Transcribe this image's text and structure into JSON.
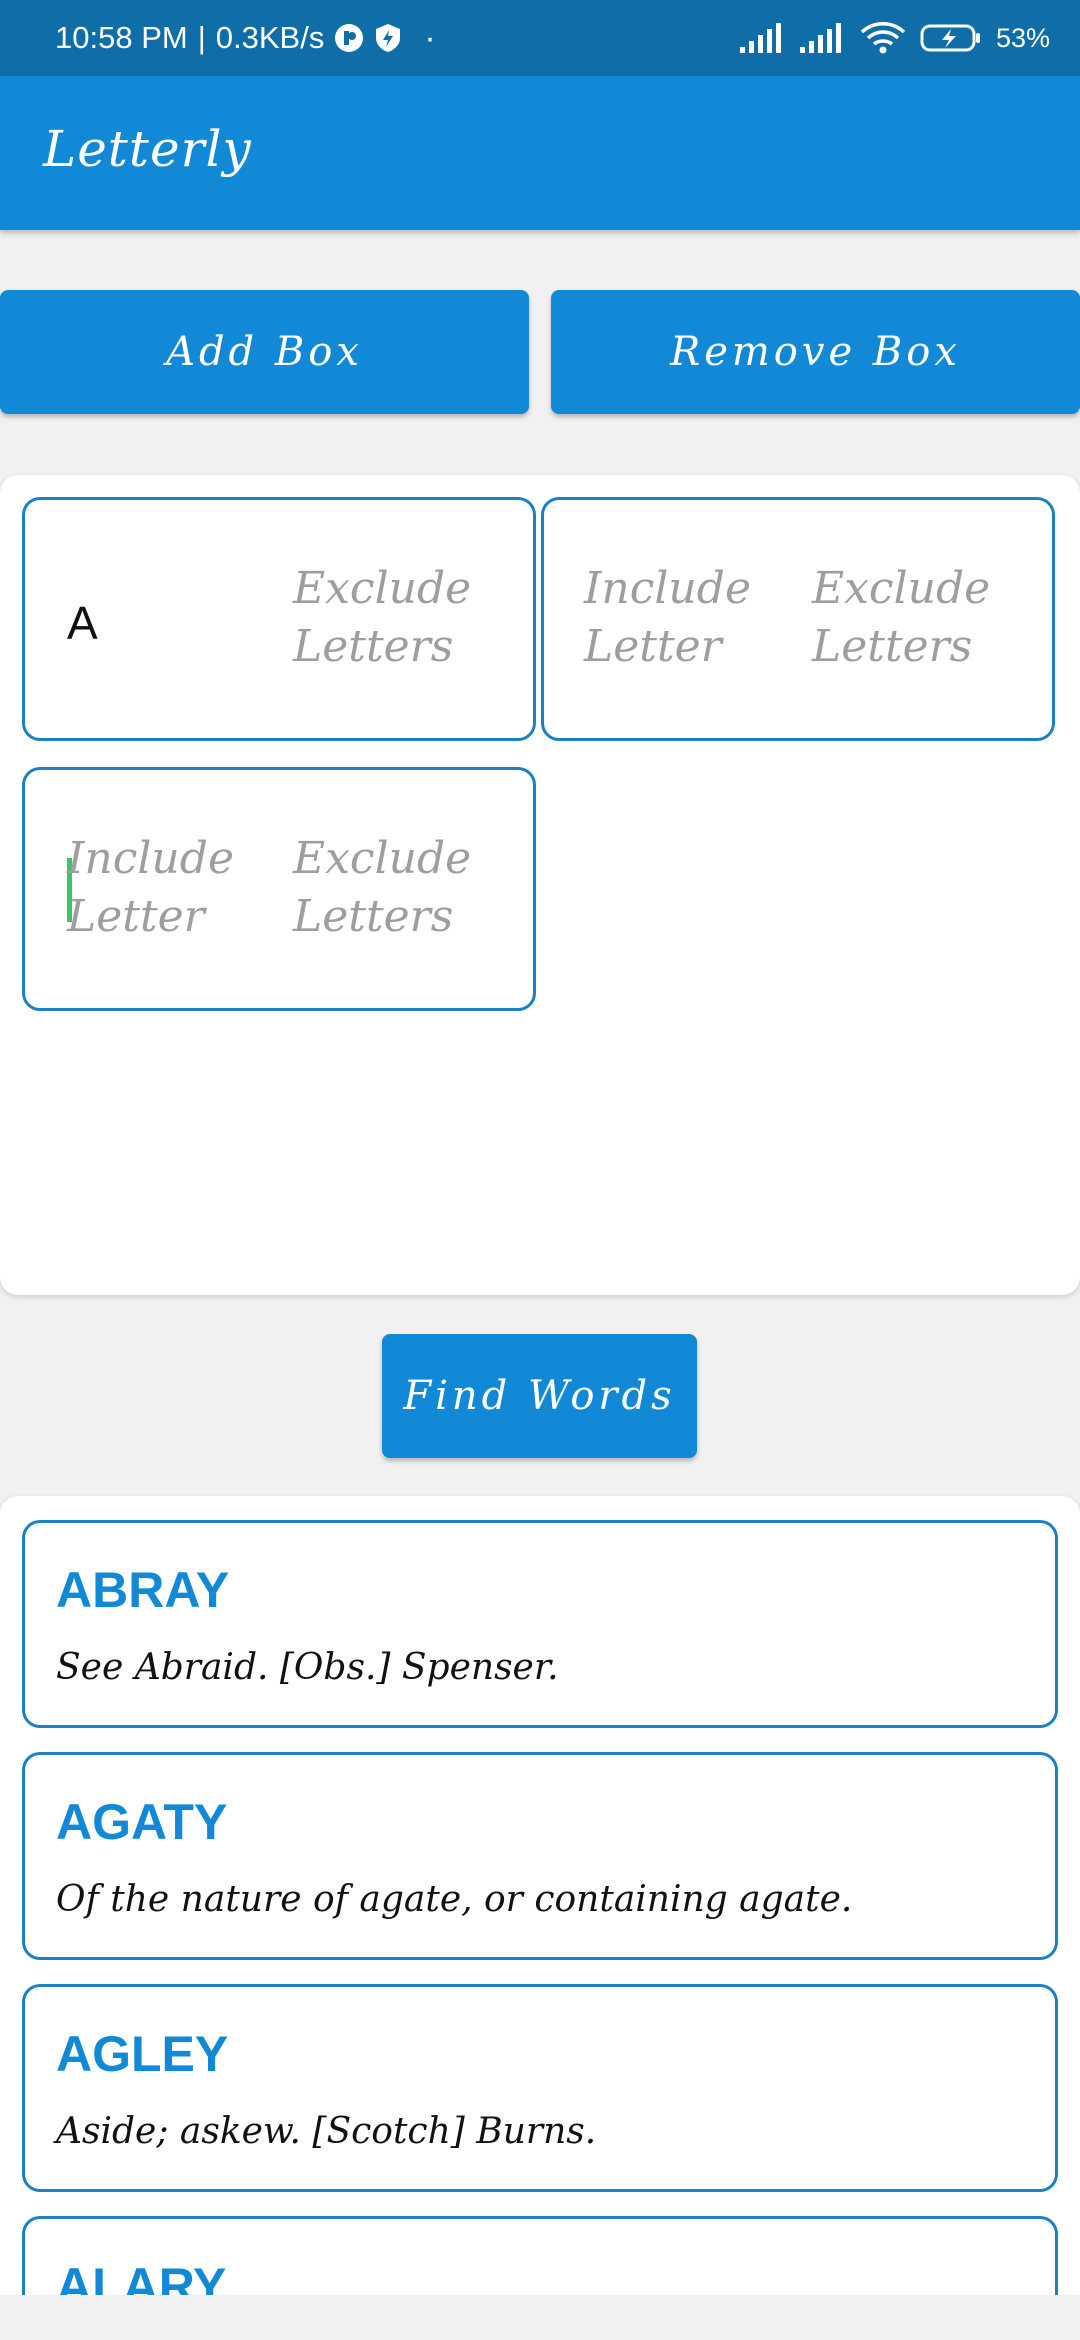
{
  "status_bar": {
    "time": "10:58 PM",
    "separator": "|",
    "speed": "0.3KB/s",
    "dot": "·",
    "battery": "53%",
    "icons": [
      "notification-app-icon",
      "shield-bolt-icon",
      "signal-icon",
      "signal-icon",
      "wifi-icon",
      "battery-charging-icon"
    ]
  },
  "app_bar": {
    "title": "Letterly"
  },
  "controls": {
    "add_box": "Add Box",
    "remove_box": "Remove Box",
    "find_words": "Find Words"
  },
  "boxes": [
    {
      "include_value": "A",
      "include_placeholder": "",
      "exclude_placeholder": "Exclude\nLetters"
    },
    {
      "include_value": "",
      "include_placeholder": "Include\nLetter",
      "exclude_placeholder": "Exclude\nLetters"
    },
    {
      "include_value": "",
      "include_placeholder": "Include\nLetter",
      "exclude_placeholder": "Exclude\nLetters"
    }
  ],
  "results": [
    {
      "word": "ABRAY",
      "definition": "See Abraid. [Obs.] Spenser."
    },
    {
      "word": "AGATY",
      "definition": "Of the nature of agate, or containing agate."
    },
    {
      "word": "AGLEY",
      "definition": "Aside; askew. [Scotch] Burns."
    },
    {
      "word": "ALARY",
      "definition": ""
    }
  ],
  "colors": {
    "status_bar": "#0f6ea8",
    "primary": "#1189d6",
    "border": "#1a82c4",
    "placeholder": "#9e9e9e",
    "cursor": "#3cc46a"
  }
}
